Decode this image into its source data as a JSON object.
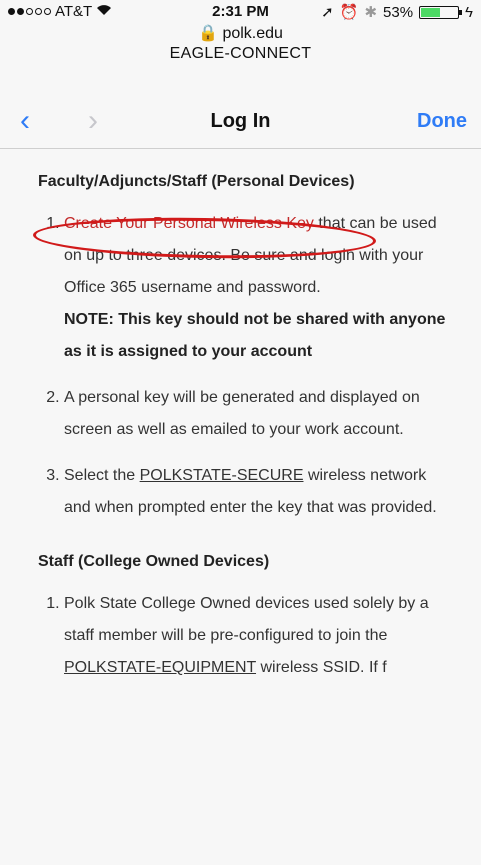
{
  "status": {
    "carrier": "AT&T",
    "time": "2:31 PM",
    "battery_text": "53%",
    "battery_level": 0.53
  },
  "url": {
    "host": "polk.edu",
    "site_name": "EAGLE-CONNECT"
  },
  "nav": {
    "title": "Log In",
    "done_label": "Done"
  },
  "section1": {
    "heading": "Faculty/Adjuncts/Staff (Personal Devices)",
    "item1_link": "Create Your Personal Wireless Key",
    "item1_text": " that can be used on up to three devices. Be sure and login with your Office 365 username and password.",
    "item1_note": "NOTE: This key should not be shared with anyone as it is assigned to your account",
    "item2_text": "A personal key will be generated and displayed on screen as well as emailed to your work account.",
    "item3_pre": "Select the ",
    "item3_link": "POLKSTATE-SECURE",
    "item3_post": " wireless network and when prompted enter the key that was provided."
  },
  "section2": {
    "heading": "Staff (College Owned Devices)",
    "item1_pre": "Polk State College Owned devices used solely by a staff member will be pre-configured to join the ",
    "item1_link": "POLKSTATE-EQUIPMENT",
    "item1_post": " wireless SSID. If f"
  }
}
